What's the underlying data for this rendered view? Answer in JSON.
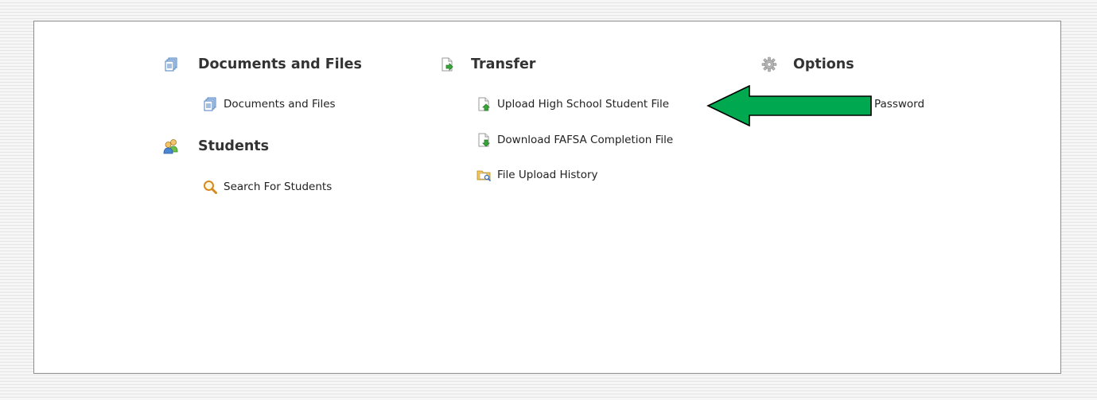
{
  "sections": {
    "documents": {
      "title": "Documents and Files",
      "icon": "documents-icon",
      "items": [
        {
          "label": "Documents and Files",
          "icon": "documents-icon"
        }
      ]
    },
    "students": {
      "title": "Students",
      "icon": "students-icon",
      "items": [
        {
          "label": "Search For Students",
          "icon": "magnifier-icon"
        }
      ]
    },
    "transfer": {
      "title": "Transfer",
      "icon": "transfer-icon",
      "items": [
        {
          "label": "Upload High School Student File",
          "icon": "upload-file-icon"
        },
        {
          "label": "Download FAFSA Completion File",
          "icon": "download-file-icon"
        },
        {
          "label": "File Upload History",
          "icon": "folder-history-icon"
        }
      ]
    },
    "options": {
      "title": "Options",
      "icon": "gear-icon",
      "items": [
        {
          "label": "Password",
          "icon": "key-icon"
        }
      ]
    }
  },
  "annotation": {
    "icon": "arrow-left-icon",
    "color": "#00a84f"
  }
}
